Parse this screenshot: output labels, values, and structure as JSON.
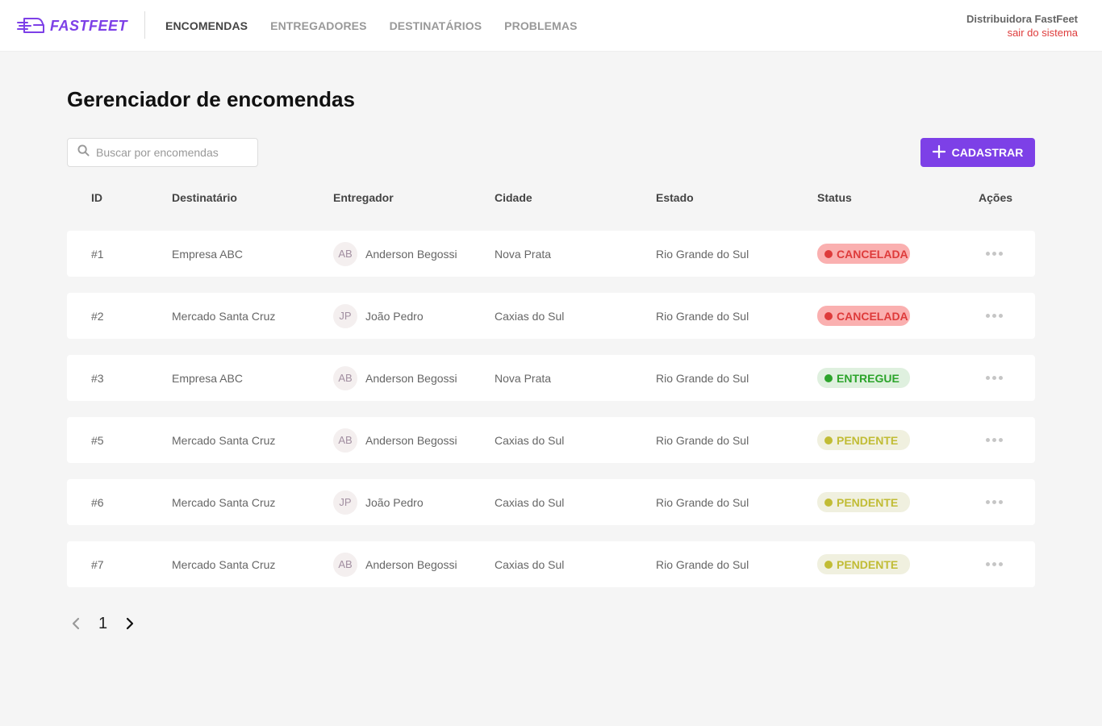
{
  "header": {
    "logo_text": "FASTFEET",
    "nav": [
      {
        "label": "ENCOMENDAS",
        "active": true
      },
      {
        "label": "ENTREGADORES",
        "active": false
      },
      {
        "label": "DESTINATÁRIOS",
        "active": false
      },
      {
        "label": "PROBLEMAS",
        "active": false
      }
    ],
    "user_name": "Distribuidora FastFeet",
    "logout_label": "sair do sistema"
  },
  "main": {
    "title": "Gerenciador de encomendas",
    "search": {
      "placeholder": "Buscar por encomendas",
      "value": ""
    },
    "add_label": "CADASTRAR",
    "columns": {
      "id": "ID",
      "recipient": "Destinatário",
      "courier": "Entregador",
      "city": "Cidade",
      "state": "Estado",
      "status": "Status",
      "actions": "Ações"
    },
    "rows": [
      {
        "id": "#1",
        "recipient": "Empresa ABC",
        "courier_initials": "AB",
        "courier": "Anderson Begossi",
        "city": "Nova Prata",
        "state": "Rio Grande do Sul",
        "status": "CANCELADA",
        "status_key": "cancelada"
      },
      {
        "id": "#2",
        "recipient": "Mercado Santa Cruz",
        "courier_initials": "JP",
        "courier": "João Pedro",
        "city": "Caxias do Sul",
        "state": "Rio Grande do Sul",
        "status": "CANCELADA",
        "status_key": "cancelada"
      },
      {
        "id": "#3",
        "recipient": "Empresa ABC",
        "courier_initials": "AB",
        "courier": "Anderson Begossi",
        "city": "Nova Prata",
        "state": "Rio Grande do Sul",
        "status": "ENTREGUE",
        "status_key": "entregue"
      },
      {
        "id": "#5",
        "recipient": "Mercado Santa Cruz",
        "courier_initials": "AB",
        "courier": "Anderson Begossi",
        "city": "Caxias do Sul",
        "state": "Rio Grande do Sul",
        "status": "PENDENTE",
        "status_key": "pendente"
      },
      {
        "id": "#6",
        "recipient": "Mercado Santa Cruz",
        "courier_initials": "JP",
        "courier": "João Pedro",
        "city": "Caxias do Sul",
        "state": "Rio Grande do Sul",
        "status": "PENDENTE",
        "status_key": "pendente"
      },
      {
        "id": "#7",
        "recipient": "Mercado Santa Cruz",
        "courier_initials": "AB",
        "courier": "Anderson Begossi",
        "city": "Caxias do Sul",
        "state": "Rio Grande do Sul",
        "status": "PENDENTE",
        "status_key": "pendente"
      }
    ],
    "pagination": {
      "current_page": "1"
    }
  },
  "icons": {
    "logo": "truck-speed-icon",
    "search": "search-icon",
    "add": "plus-icon",
    "actions": "more-horizontal-icon",
    "prev": "chevron-left-icon",
    "next": "chevron-right-icon"
  },
  "colors": {
    "brand": "#7d40e7",
    "logout": "#de3b3b",
    "cancelada": "#de3b3b",
    "entregue": "#2ca42b",
    "pendente": "#c1bc35"
  }
}
